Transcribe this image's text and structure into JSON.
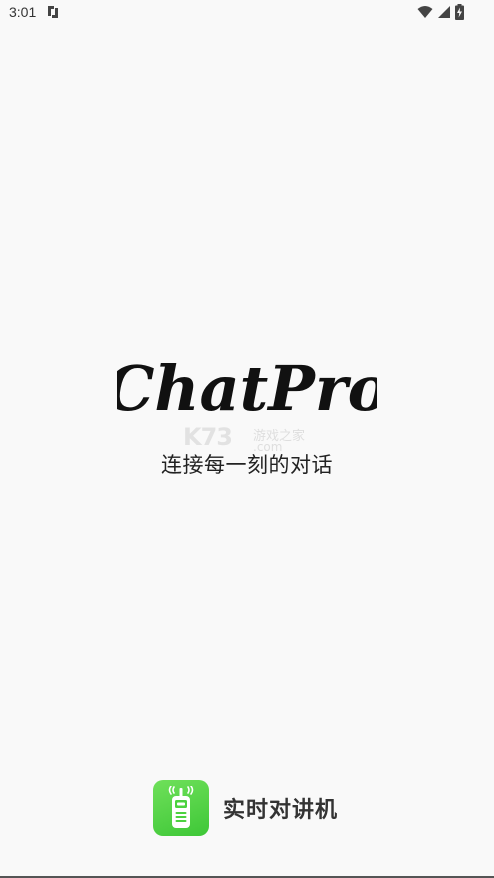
{
  "status_bar": {
    "time": "3:01",
    "icons": [
      "sync-app-icon",
      "wifi-icon",
      "cellular-signal-icon",
      "battery-charging-icon"
    ]
  },
  "splash": {
    "logo_text": "ChatPro",
    "tagline": "连接每一刻的对话",
    "watermark": {
      "main": "K73",
      "cn": "游戏之家",
      "com": ".com"
    }
  },
  "brand": {
    "name": "实时对讲机",
    "icon": "walkie-talkie-icon",
    "icon_color": "#4cd23f"
  },
  "colors": {
    "background": "#f9f9f9",
    "logo": "#111111",
    "text": "#222222"
  }
}
